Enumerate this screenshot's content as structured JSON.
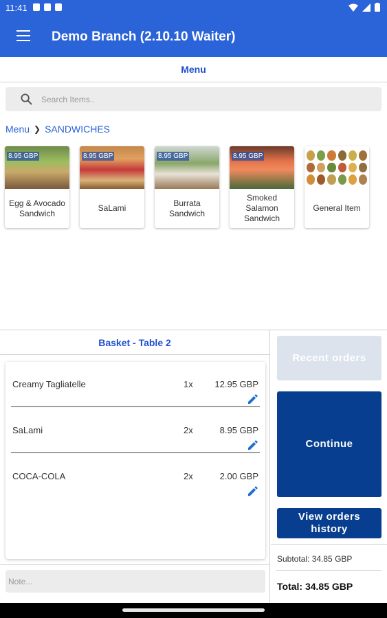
{
  "status": {
    "time": "11:41"
  },
  "appbar": {
    "title": "Demo Branch (2.10.10 Waiter)"
  },
  "menu": {
    "header": "Menu"
  },
  "search": {
    "placeholder": "Search Items.."
  },
  "breadcrumb": {
    "root": "Menu",
    "current": "SANDWICHES"
  },
  "items": [
    {
      "price": "8.95 GBP",
      "name": "Egg & Avocado Sandwich"
    },
    {
      "price": "8.95 GBP",
      "name": "SaLami"
    },
    {
      "price": "8.95 GBP",
      "name": "Burrata Sandwich"
    },
    {
      "price": "8.95 GBP",
      "name": "Smoked Salamon Sandwich"
    },
    {
      "price": "",
      "name": "General Item"
    }
  ],
  "basket": {
    "title": "Basket - Table 2",
    "rows": [
      {
        "name": "Creamy Tagliatelle",
        "qty": "1x",
        "price": "12.95 GBP"
      },
      {
        "name": "SaLami",
        "qty": "2x",
        "price": "8.95 GBP"
      },
      {
        "name": "COCA-COLA",
        "qty": "2x",
        "price": "2.00 GBP"
      }
    ],
    "note_placeholder": "Note..."
  },
  "side": {
    "recent_orders": "Recent orders",
    "continue": "Continue",
    "history_line1": "View orders",
    "history_line2": "history",
    "subtotal": "Subtotal: 34.85 GBP",
    "total": "Total: 34.85 GBP"
  },
  "colors": {
    "primary": "#2b63d9",
    "dark_button": "#073e8f",
    "disabled_button": "#dde3ec"
  }
}
